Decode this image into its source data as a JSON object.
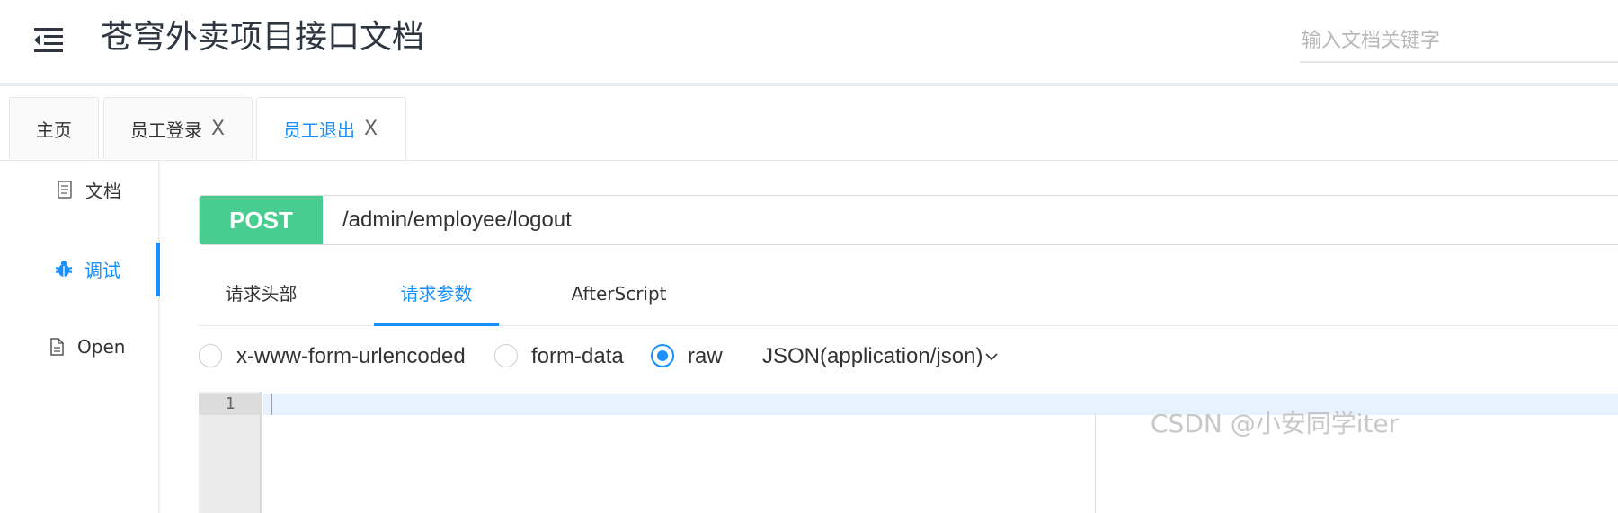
{
  "header": {
    "title": "苍穹外卖项目接口文档",
    "menu_icon": "menu-fold-icon",
    "search_placeholder": "输入文档关键字"
  },
  "tabs": [
    {
      "label": "主页",
      "closable": false,
      "active": false
    },
    {
      "label": "员工登录",
      "closable": true,
      "close_symbol": "X",
      "active": false
    },
    {
      "label": "员工退出",
      "closable": true,
      "close_symbol": "X",
      "active": true
    }
  ],
  "sidebar": {
    "items": [
      {
        "label": "文档",
        "icon": "document-icon",
        "active": false
      },
      {
        "label": "调试",
        "icon": "bug-icon",
        "active": true
      },
      {
        "label": "Open",
        "icon": "file-icon",
        "active": false
      }
    ]
  },
  "request": {
    "method": "POST",
    "url": "/admin/employee/logout"
  },
  "subtabs": [
    {
      "label": "请求头部",
      "active": false
    },
    {
      "label": "请求参数",
      "active": true
    },
    {
      "label": "AfterScript",
      "active": false
    }
  ],
  "body_options": {
    "types": [
      {
        "label": "x-www-form-urlencoded",
        "checked": false
      },
      {
        "label": "form-data",
        "checked": false
      },
      {
        "label": "raw",
        "checked": true
      }
    ],
    "content_type": "JSON(application/json)"
  },
  "editor": {
    "line_numbers": [
      "1"
    ]
  },
  "watermark": "CSDN @小安同学iter",
  "colors": {
    "accent": "#1890ff",
    "method_post": "#49cc90",
    "text": "#333333",
    "title": "#2f3642"
  }
}
